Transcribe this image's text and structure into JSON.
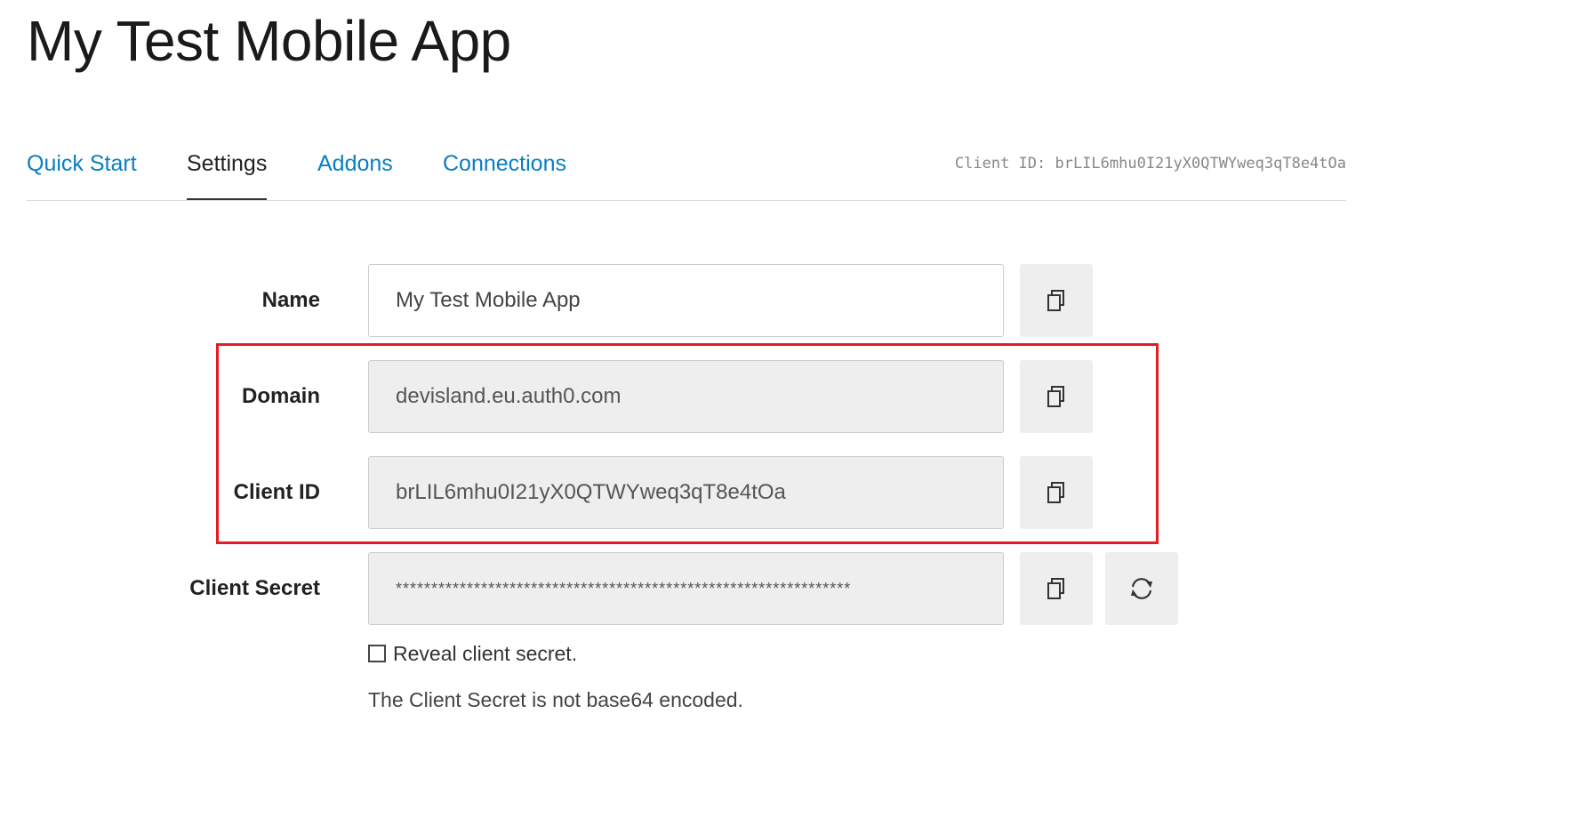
{
  "page": {
    "title": "My Test Mobile App"
  },
  "tabs": [
    {
      "label": "Quick Start",
      "active": false
    },
    {
      "label": "Settings",
      "active": true
    },
    {
      "label": "Addons",
      "active": false
    },
    {
      "label": "Connections",
      "active": false
    }
  ],
  "header": {
    "client_id_text": "Client ID: brLIL6mhu0I21yX0QTWYweq3qT8e4tOa"
  },
  "fields": {
    "name": {
      "label": "Name",
      "value": "My Test Mobile App"
    },
    "domain": {
      "label": "Domain",
      "value": "devisland.eu.auth0.com"
    },
    "client_id": {
      "label": "Client ID",
      "value": "brLIL6mhu0I21yX0QTWYweq3qT8e4tOa"
    },
    "client_secret": {
      "label": "Client Secret",
      "value": "****************************************************************"
    }
  },
  "reveal_secret": {
    "label": "Reveal client secret.",
    "checked": false
  },
  "help_text": "The Client Secret is not base64 encoded.",
  "icons": {
    "copy": "copy-icon",
    "rotate": "rotate-icon"
  },
  "colors": {
    "link": "#0a7ec2",
    "highlight": "#e31c25",
    "readonly_bg": "#eeeeee"
  }
}
